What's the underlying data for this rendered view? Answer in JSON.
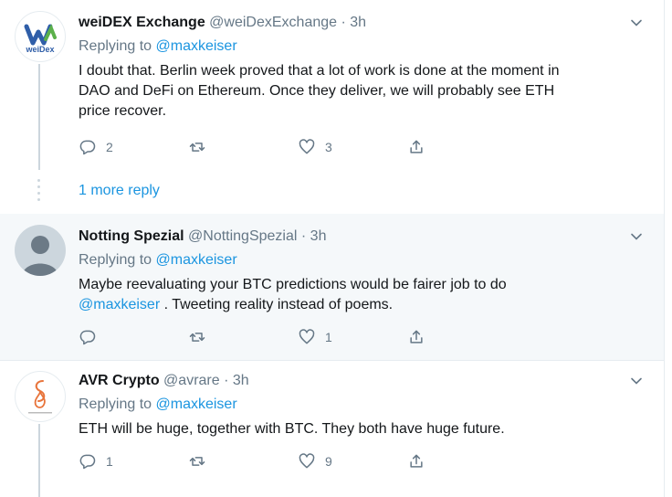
{
  "tweets": [
    {
      "name": "weiDEX Exchange",
      "handle": "@weiDexExchange",
      "dot": "·",
      "time": "3h",
      "replying_prefix": "Replying to ",
      "replying_to": "@maxkeiser",
      "body_lines": [
        "I doubt that. Berlin week proved that a lot of work is done at the moment in",
        "DAO and DeFi on Ethereum. Once they deliver, we will probably see ETH",
        "price recover."
      ],
      "replies": "2",
      "retweets": "",
      "likes": "3",
      "avatar_text": "weiDex"
    },
    {
      "name": "Notting Spezial",
      "handle": "@NottingSpezial",
      "dot": "·",
      "time": "3h",
      "replying_prefix": "Replying to ",
      "replying_to": "@maxkeiser",
      "body_line1": "Maybe reevaluating your BTC predictions would be fairer job to do",
      "body_mention": "@maxkeiser",
      "body_line2_rest": " . Tweeting reality instead of poems.",
      "replies": "",
      "retweets": "",
      "likes": "1"
    },
    {
      "name": "AVR Crypto",
      "handle": "@avrare",
      "dot": "·",
      "time": "3h",
      "replying_prefix": "Replying to ",
      "replying_to": "@maxkeiser",
      "body_lines": [
        "ETH will be huge, together with BTC. They both have huge future."
      ],
      "replies": "1",
      "retweets": "",
      "likes": "9"
    }
  ],
  "more_replies": "1 more reply",
  "colors": {
    "link": "#1b95e0",
    "muted": "#657786",
    "highlight_bg": "#f5f8fa"
  }
}
